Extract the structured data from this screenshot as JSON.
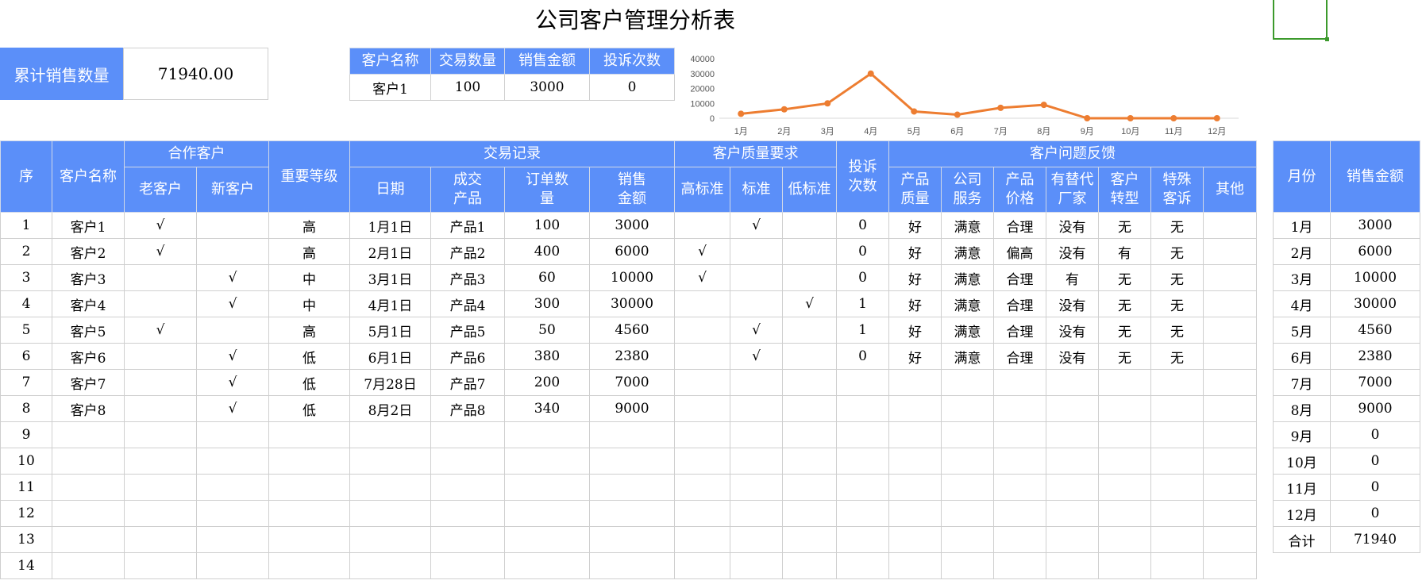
{
  "title": "公司客户管理分析表",
  "cumulative": {
    "label": "累计销售数量",
    "value": "71940.00"
  },
  "summary": {
    "headers": [
      "客户名称",
      "交易数量",
      "销售金额",
      "投诉次数"
    ],
    "row": [
      "客户1",
      "100",
      "3000",
      "0"
    ]
  },
  "chart_data": {
    "type": "line",
    "categories": [
      "1月",
      "2月",
      "3月",
      "4月",
      "5月",
      "6月",
      "7月",
      "8月",
      "9月",
      "10月",
      "11月",
      "12月"
    ],
    "values": [
      3000,
      6000,
      10000,
      30000,
      4560,
      2380,
      7000,
      9000,
      0,
      0,
      0,
      0
    ],
    "yticks": [
      "40000",
      "30000",
      "20000",
      "10000",
      "0"
    ],
    "ylim": [
      0,
      40000
    ],
    "color": "#ed7d31"
  },
  "main": {
    "h_seq": "序",
    "h_name": "客户名称",
    "h_coop": "合作客户",
    "h_old": "老客户",
    "h_new": "新客户",
    "h_level": "重要等级",
    "h_trade": "交易记录",
    "h_date": "日期",
    "h_product": "成交产品",
    "h_qty": "订单数量",
    "h_amount": "销售金额",
    "h_quality": "客户质量要求",
    "h_high": "高标准",
    "h_std": "标准",
    "h_low": "低标准",
    "h_complaints": "投诉次数",
    "h_feedback": "客户问题反馈",
    "h_pq": "产品质量",
    "h_cs": "公司服务",
    "h_price": "产品价格",
    "h_alt": "有替代厂家",
    "h_trans": "客户转型",
    "h_special": "特殊客诉",
    "h_other": "其他",
    "rows": [
      [
        "1",
        "客户1",
        "√",
        "",
        "高",
        "1月1日",
        "产品1",
        "100",
        "3000",
        "",
        "√",
        "",
        "0",
        "好",
        "满意",
        "合理",
        "没有",
        "无",
        "无",
        ""
      ],
      [
        "2",
        "客户2",
        "√",
        "",
        "高",
        "2月1日",
        "产品2",
        "400",
        "6000",
        "√",
        "",
        "",
        "0",
        "好",
        "满意",
        "偏高",
        "没有",
        "有",
        "无",
        ""
      ],
      [
        "3",
        "客户3",
        "",
        "√",
        "中",
        "3月1日",
        "产品3",
        "60",
        "10000",
        "√",
        "",
        "",
        "0",
        "好",
        "满意",
        "合理",
        "有",
        "无",
        "无",
        ""
      ],
      [
        "4",
        "客户4",
        "",
        "√",
        "中",
        "4月1日",
        "产品4",
        "300",
        "30000",
        "",
        "",
        "√",
        "1",
        "好",
        "满意",
        "合理",
        "没有",
        "无",
        "无",
        ""
      ],
      [
        "5",
        "客户5",
        "√",
        "",
        "高",
        "5月1日",
        "产品5",
        "50",
        "4560",
        "",
        "√",
        "",
        "1",
        "好",
        "满意",
        "合理",
        "没有",
        "无",
        "无",
        ""
      ],
      [
        "6",
        "客户6",
        "",
        "√",
        "低",
        "6月1日",
        "产品6",
        "380",
        "2380",
        "",
        "√",
        "",
        "0",
        "好",
        "满意",
        "合理",
        "没有",
        "无",
        "无",
        ""
      ],
      [
        "7",
        "客户7",
        "",
        "√",
        "低",
        "7月28日",
        "产品7",
        "200",
        "7000",
        "",
        "",
        "",
        "",
        "",
        "",
        "",
        "",
        "",
        "",
        ""
      ],
      [
        "8",
        "客户8",
        "",
        "√",
        "低",
        "8月2日",
        "产品8",
        "340",
        "9000",
        "",
        "",
        "",
        "",
        "",
        "",
        "",
        "",
        "",
        "",
        ""
      ],
      [
        "9",
        "",
        "",
        "",
        "",
        "",
        "",
        "",
        "",
        "",
        "",
        "",
        "",
        "",
        "",
        "",
        "",
        "",
        "",
        ""
      ],
      [
        "10",
        "",
        "",
        "",
        "",
        "",
        "",
        "",
        "",
        "",
        "",
        "",
        "",
        "",
        "",
        "",
        "",
        "",
        "",
        ""
      ],
      [
        "11",
        "",
        "",
        "",
        "",
        "",
        "",
        "",
        "",
        "",
        "",
        "",
        "",
        "",
        "",
        "",
        "",
        "",
        "",
        ""
      ],
      [
        "12",
        "",
        "",
        "",
        "",
        "",
        "",
        "",
        "",
        "",
        "",
        "",
        "",
        "",
        "",
        "",
        "",
        "",
        "",
        ""
      ],
      [
        "13",
        "",
        "",
        "",
        "",
        "",
        "",
        "",
        "",
        "",
        "",
        "",
        "",
        "",
        "",
        "",
        "",
        "",
        "",
        ""
      ],
      [
        "14",
        "",
        "",
        "",
        "",
        "",
        "",
        "",
        "",
        "",
        "",
        "",
        "",
        "",
        "",
        "",
        "",
        "",
        "",
        ""
      ]
    ]
  },
  "monthly": {
    "h_month": "月份",
    "h_sales": "销售金额",
    "rows": [
      [
        "1月",
        "3000"
      ],
      [
        "2月",
        "6000"
      ],
      [
        "3月",
        "10000"
      ],
      [
        "4月",
        "30000"
      ],
      [
        "5月",
        "4560"
      ],
      [
        "6月",
        "2380"
      ],
      [
        "7月",
        "7000"
      ],
      [
        "8月",
        "9000"
      ],
      [
        "9月",
        "0"
      ],
      [
        "10月",
        "0"
      ],
      [
        "11月",
        "0"
      ],
      [
        "12月",
        "0"
      ],
      [
        "合计",
        "71940"
      ]
    ]
  }
}
